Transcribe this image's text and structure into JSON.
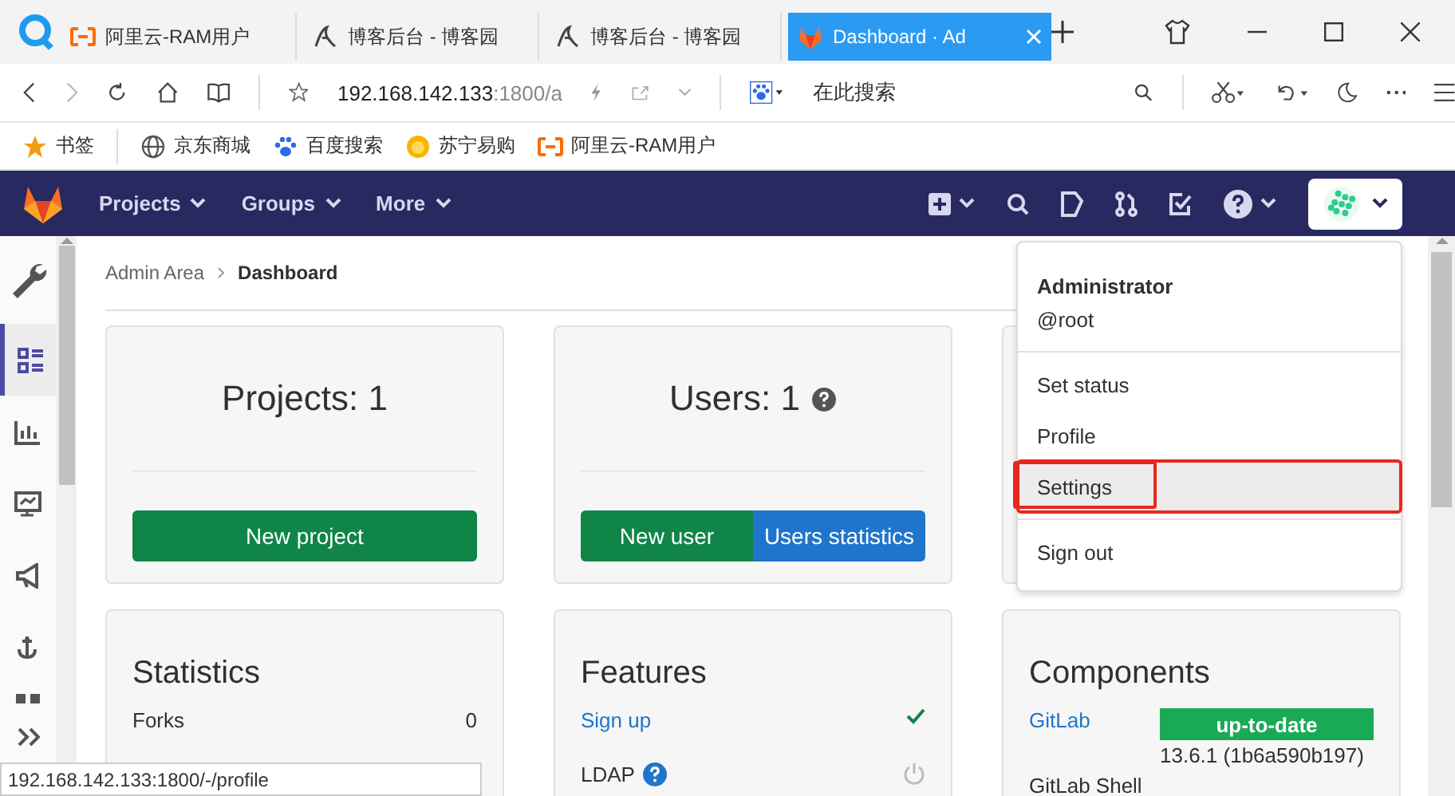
{
  "browser": {
    "tabs": [
      {
        "label": "阿里云-RAM用户",
        "selected": false
      },
      {
        "label": "博客后台 - 博客园",
        "selected": false
      },
      {
        "label": "博客后台 - 博客园",
        "selected": false
      },
      {
        "label": "Dashboard · Ad",
        "selected": true
      }
    ],
    "address": {
      "host": "192.168.142.133",
      "rest": ":1800/a"
    },
    "search": {
      "placeholder": "在此搜索"
    },
    "bookmarks": [
      {
        "label": "书签"
      },
      {
        "label": "京东商城"
      },
      {
        "label": "百度搜索"
      },
      {
        "label": "苏宁易购"
      },
      {
        "label": "阿里云-RAM用户"
      }
    ]
  },
  "navbar": {
    "items": [
      "Projects",
      "Groups",
      "More"
    ]
  },
  "sidebar": {
    "items": [
      {
        "kind": "overview",
        "selected": true
      },
      {
        "kind": "analytics",
        "selected": false
      },
      {
        "kind": "monitoring",
        "selected": false
      },
      {
        "kind": "messages",
        "selected": false
      },
      {
        "kind": "hooks",
        "selected": false
      },
      {
        "kind": "apps",
        "selected": false
      }
    ]
  },
  "breadcrumb": [
    "Admin Area",
    "Dashboard"
  ],
  "summary_cards": [
    {
      "title": "Projects: 1",
      "help": false,
      "buttons": [
        {
          "label": "New project",
          "kind": "primary"
        }
      ]
    },
    {
      "title": "Users: 1",
      "help": true,
      "buttons": [
        {
          "label": "New user",
          "kind": "primary"
        },
        {
          "label": "Users statistics",
          "kind": "info"
        }
      ]
    }
  ],
  "statistics": {
    "title": "Statistics",
    "rows": [
      {
        "label": "Forks",
        "value": "0"
      }
    ]
  },
  "features": {
    "title": "Features",
    "rows": [
      {
        "label": "Sign up",
        "help": false,
        "enabled": true
      },
      {
        "label": "LDAP",
        "help": true,
        "enabled": false
      }
    ]
  },
  "components": {
    "title": "Components",
    "rows": [
      {
        "name": "GitLab",
        "badge": "up-to-date",
        "version": "13.6.1 (1b6a590b197)"
      },
      {
        "name": "GitLab Shell"
      }
    ]
  },
  "user_menu": {
    "name": "Administrator",
    "handle": "@root",
    "groups": [
      [
        {
          "label": "Set status",
          "selected": false,
          "annotated": false
        },
        {
          "label": "Profile",
          "selected": false,
          "annotated": false
        },
        {
          "label": "Settings",
          "selected": true,
          "annotated": true
        }
      ],
      [
        {
          "label": "Sign out",
          "selected": false,
          "annotated": false
        }
      ]
    ]
  },
  "status_url": "192.168.142.133:1800/-/profile"
}
